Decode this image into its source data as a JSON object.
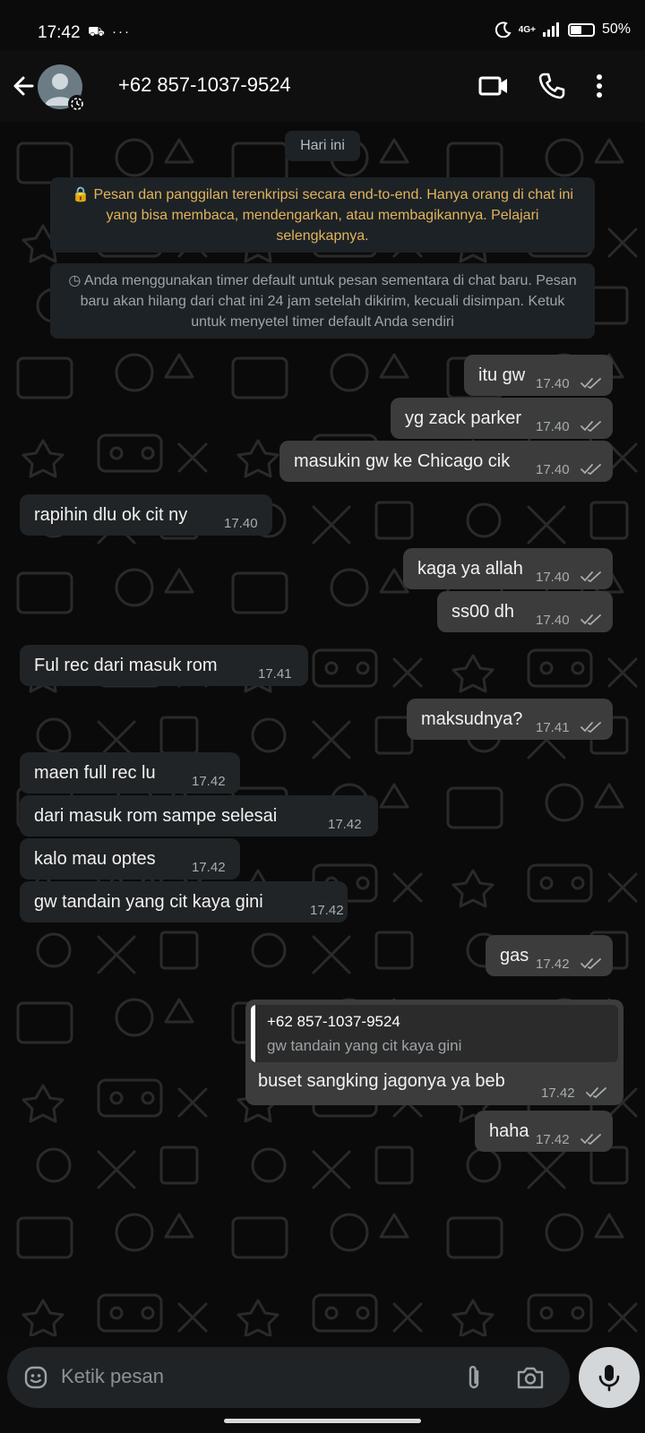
{
  "status_bar": {
    "time": "17:42",
    "left_icons": "⛟ ···",
    "network": "4G+",
    "battery": "50%",
    "battery_level": 0.5
  },
  "header": {
    "contact": "+62 857-1037-9524"
  },
  "chat": {
    "date_label": "Hari ini",
    "encryption_notice": "🔒 Pesan dan panggilan terenkripsi secara end-to-end. Hanya orang di chat ini yang bisa membaca, mendengarkan, atau membagikannya. Pelajari selengkapnya.",
    "timer_notice": "◷ Anda menggunakan timer default untuk pesan sementara di chat baru. Pesan baru akan hilang dari chat ini 24 jam setelah dikirim, kecuali disimpan. Ketuk untuk menyetel timer default Anda sendiri",
    "messages": [
      {
        "dir": "out",
        "text": "itu gw",
        "time": "17.40"
      },
      {
        "dir": "out",
        "text": "yg zack parker",
        "time": "17.40"
      },
      {
        "dir": "out",
        "text": "masukin gw ke Chicago cik",
        "time": "17.40"
      },
      {
        "dir": "in",
        "text": "rapihin dlu ok cit ny",
        "time": "17.40"
      },
      {
        "dir": "out",
        "text": "kaga ya allah",
        "time": "17.40"
      },
      {
        "dir": "out",
        "text": "ss00 dh",
        "time": "17.40"
      },
      {
        "dir": "in",
        "text": "Ful rec dari masuk rom",
        "time": "17.41"
      },
      {
        "dir": "out",
        "text": "maksudnya?",
        "time": "17.41"
      },
      {
        "dir": "in",
        "text": "maen full rec lu",
        "time": "17.42"
      },
      {
        "dir": "in",
        "text": "dari masuk rom sampe selesai",
        "time": "17.42"
      },
      {
        "dir": "in",
        "text": "kalo mau optes",
        "time": "17.42"
      },
      {
        "dir": "in",
        "text": "gw tandain yang cit kaya gini",
        "time": "17.42"
      },
      {
        "dir": "out",
        "text": "gas",
        "time": "17.42"
      },
      {
        "dir": "out",
        "text": "haha",
        "time": "17.42"
      }
    ],
    "reply_message": {
      "quoted_author": "+62 857-1037-9524",
      "quoted_text": "gw tandain yang cit kaya gini",
      "text": "buset sangking jagonya ya beb",
      "time": "17.42"
    }
  },
  "input": {
    "placeholder": "Ketik pesan"
  },
  "icons": {
    "back": "arrow-left-icon",
    "video": "video-call-icon",
    "call": "phone-icon",
    "menu": "more-vertical-icon",
    "emoji": "emoji-icon",
    "attach": "paperclip-icon",
    "camera": "camera-icon",
    "mic": "mic-icon",
    "read": "double-check-icon"
  },
  "colors": {
    "outgoing_bubble": "#3c3c3c",
    "incoming_bubble": "#202426",
    "encryption_text": "#e2b45a"
  }
}
